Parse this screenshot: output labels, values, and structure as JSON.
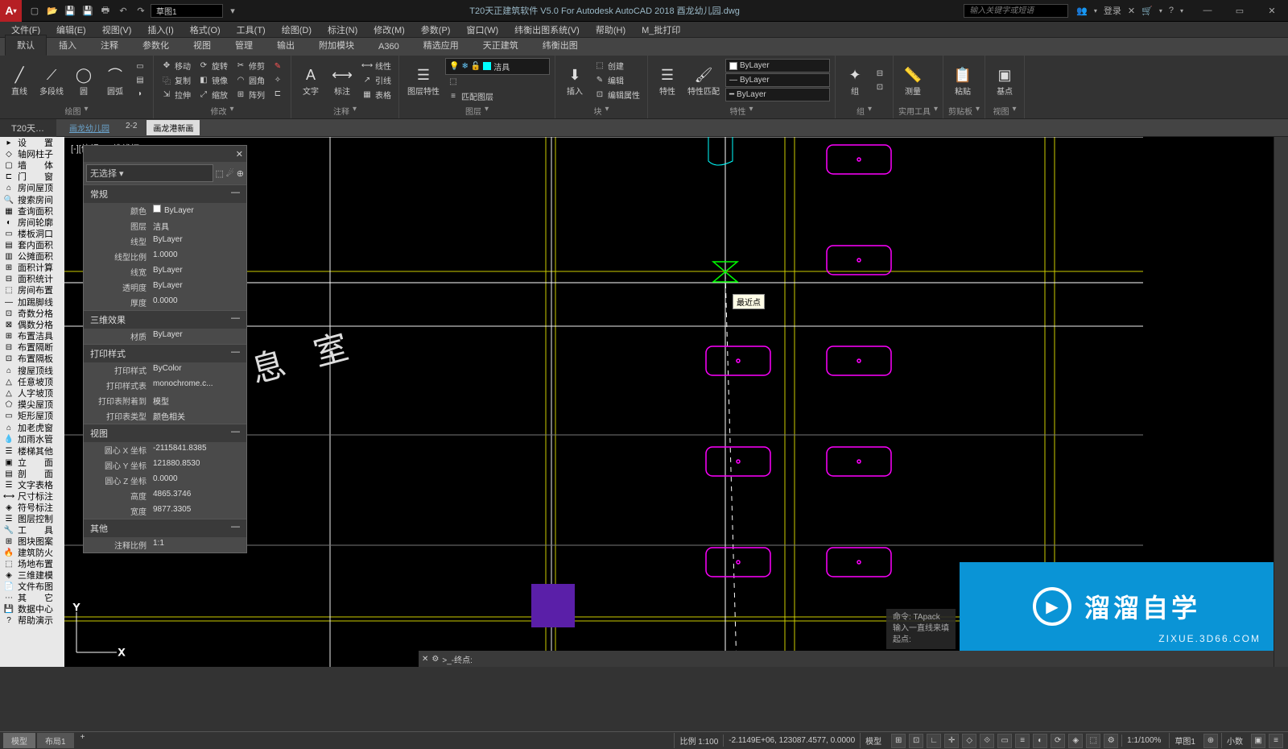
{
  "app": {
    "badge": "A",
    "title": "T20天正建筑软件 V5.0 For Autodesk AutoCAD 2018   酉龙幼儿园.dwg",
    "qat_field": "草图1",
    "search_ph": "输入关键字或短语",
    "login": "登录"
  },
  "menubar": [
    "文件(F)",
    "编辑(E)",
    "视图(V)",
    "插入(I)",
    "格式(O)",
    "工具(T)",
    "绘图(D)",
    "标注(N)",
    "修改(M)",
    "参数(P)",
    "窗口(W)",
    "纬衡出图系统(V)",
    "帮助(H)",
    "M_批打印"
  ],
  "ribbon_tabs": [
    "默认",
    "插入",
    "注释",
    "参数化",
    "视图",
    "管理",
    "输出",
    "附加模块",
    "A360",
    "精选应用",
    "天正建筑",
    "纬衡出图"
  ],
  "ribbon": {
    "draw": {
      "btns": [
        "直线",
        "多段线",
        "圆",
        "圆弧"
      ],
      "label": "绘图"
    },
    "modify": {
      "rows": [
        [
          "移动",
          "旋转",
          "修剪"
        ],
        [
          "复制",
          "镜像",
          "圆角"
        ],
        [
          "拉伸",
          "缩放",
          "阵列"
        ]
      ],
      "label": "修改"
    },
    "annot": {
      "big": [
        "文字",
        "标注"
      ],
      "rows": [
        "线性",
        "引线",
        "表格"
      ],
      "label": "注释"
    },
    "layer": {
      "big": "图层特性",
      "rows": [
        "",
        "",
        "匹配图层"
      ],
      "cur": "洁具",
      "label": "图层"
    },
    "block": {
      "big": "插入",
      "rows": [
        "创建",
        "编辑",
        "编辑属性"
      ],
      "label": "块"
    },
    "props": {
      "big": [
        "特性",
        "特性匹配"
      ],
      "dd1": "ByLayer",
      "dd2": "ByLayer",
      "dd3": "ByLayer",
      "label": "特性"
    },
    "group": {
      "big": "组",
      "label": "组"
    },
    "util": {
      "big": "测量",
      "label": "实用工具"
    },
    "clip": {
      "big": "粘贴",
      "label": "剪贴板"
    },
    "view": {
      "big": "基点",
      "label": "视图"
    }
  },
  "doc_tabs": {
    "main": "T20天…",
    "sub": [
      "画龙幼儿园",
      "2-2",
      "画龙港新画"
    ]
  },
  "view_label": "[-][俯视][二维线框]",
  "palette_groups": [
    [
      "设　　置",
      "轴网柱子",
      "墙　　体",
      "门　　窗",
      "房间屋顶"
    ],
    [
      "搜索房间",
      "查询面积",
      "房间轮廓",
      "楼板洞口",
      "套内面积",
      "公摊面积",
      "面积计算",
      "面积统计",
      "房间布置"
    ],
    [
      "加踢脚线",
      "奇数分格",
      "偶数分格",
      "布置洁具",
      "布置隔断",
      "布置隔板"
    ],
    [
      "搜屋顶线",
      "任意坡顶",
      "人字坡顶",
      "摸尖屋顶",
      "矩形屋顶"
    ],
    [
      "加老虎窗",
      "加雨水管"
    ],
    [
      "楼梯其他",
      "立　　面",
      "剖　　面",
      "文字表格",
      "尺寸标注",
      "符号标注",
      "图层控制",
      "工　　具",
      "图块图案",
      "建筑防火",
      "场地布置",
      "三维建模",
      "文件布图",
      "其　　它",
      "数据中心",
      "帮助演示"
    ]
  ],
  "props": {
    "title": "无选择",
    "sections": {
      "general": {
        "label": "常规",
        "rows": [
          [
            "颜色",
            "ByLayer"
          ],
          [
            "图层",
            "洁具"
          ],
          [
            "线型",
            "ByLayer"
          ],
          [
            "线型比例",
            "1.0000"
          ],
          [
            "线宽",
            "ByLayer"
          ],
          [
            "透明度",
            "ByLayer"
          ],
          [
            "厚度",
            "0.0000"
          ]
        ]
      },
      "threed": {
        "label": "三维效果",
        "rows": [
          [
            "材质",
            "ByLayer"
          ]
        ]
      },
      "plot": {
        "label": "打印样式",
        "rows": [
          [
            "打印样式",
            "ByColor"
          ],
          [
            "打印样式表",
            "monochrome.c..."
          ],
          [
            "打印表附着到",
            "模型"
          ],
          [
            "打印表类型",
            "颜色相关"
          ]
        ]
      },
      "view": {
        "label": "视图",
        "rows": [
          [
            "圆心 X 坐标",
            "-2115841.8385"
          ],
          [
            "圆心 Y 坐标",
            "121880.8530"
          ],
          [
            "圆心 Z 坐标",
            "0.0000"
          ],
          [
            "高度",
            "4865.3746"
          ],
          [
            "宽度",
            "9877.3305"
          ]
        ]
      },
      "other": {
        "label": "其他",
        "rows": [
          [
            "注释比例",
            "1:1"
          ]
        ]
      }
    }
  },
  "snap": {
    "tooltip": "最近点"
  },
  "cmd": {
    "prefix": ">_-终点:",
    "hint": [
      "命令: TApack",
      "输入一直线来填",
      "起点:"
    ]
  },
  "status": {
    "tabs": [
      "模型",
      "布局1"
    ],
    "scale_lbl": "比例 1:100",
    "coords": "-2.1149E+06, 123087.4577, 0.0000",
    "model": "模型",
    "right": [
      "1:1/100%",
      "草图1",
      "小数"
    ]
  },
  "watermark": {
    "text": "溜溜自学",
    "sub": "ZIXUE.3D66.COM"
  },
  "canvas_text": "息 室"
}
